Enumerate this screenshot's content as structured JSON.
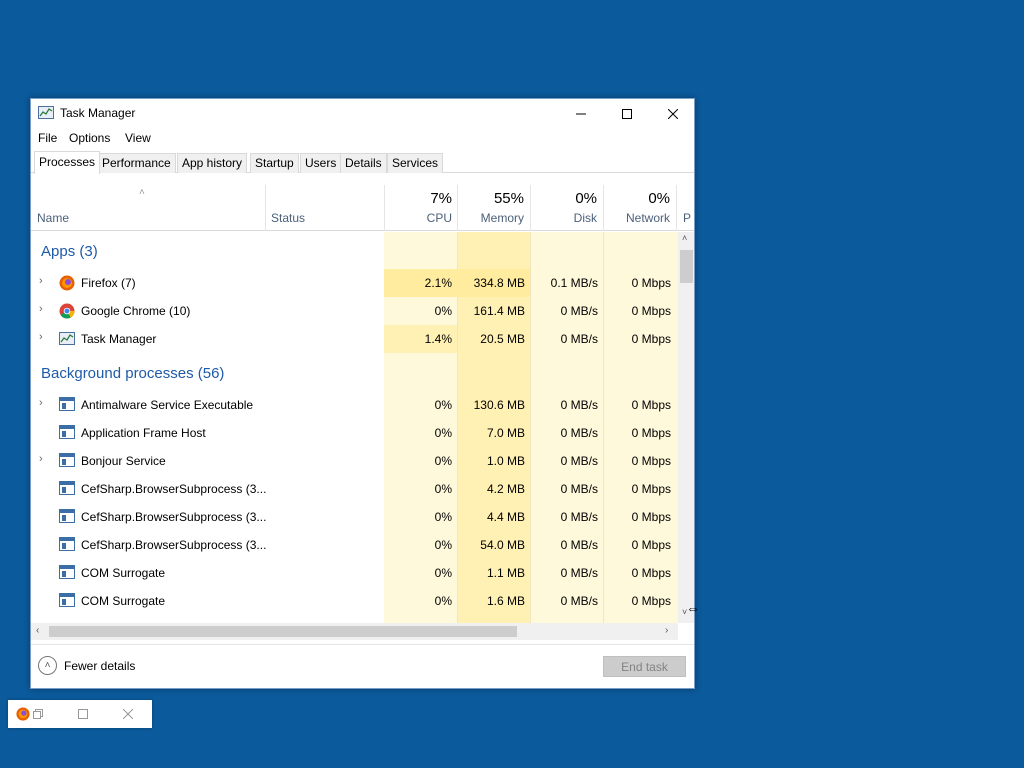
{
  "window": {
    "title": "Task Manager",
    "min_icon": "minimize-icon",
    "max_icon": "maximize-icon",
    "close_icon": "close-icon"
  },
  "menu": [
    "File",
    "Options",
    "View"
  ],
  "tabs": [
    "Processes",
    "Performance",
    "App history",
    "Startup",
    "Users",
    "Details",
    "Services"
  ],
  "columns": {
    "name": "Name",
    "status": "Status",
    "cpu": {
      "pct": "7%",
      "label": "CPU"
    },
    "memory": {
      "pct": "55%",
      "label": "Memory"
    },
    "disk": {
      "pct": "0%",
      "label": "Disk"
    },
    "network": {
      "pct": "0%",
      "label": "Network"
    },
    "extra": "P"
  },
  "groups": {
    "apps": "Apps (3)",
    "background": "Background processes (56)"
  },
  "apps": [
    {
      "name": "Firefox (7)",
      "cpu": "2.1%",
      "mem": "334.8 MB",
      "disk": "0.1 MB/s",
      "net": "0 Mbps"
    },
    {
      "name": "Google Chrome (10)",
      "cpu": "0%",
      "mem": "161.4 MB",
      "disk": "0 MB/s",
      "net": "0 Mbps"
    },
    {
      "name": "Task Manager",
      "cpu": "1.4%",
      "mem": "20.5 MB",
      "disk": "0 MB/s",
      "net": "0 Mbps"
    }
  ],
  "background": [
    {
      "name": "Antimalware Service Executable",
      "cpu": "0%",
      "mem": "130.6 MB",
      "disk": "0 MB/s",
      "net": "0 Mbps"
    },
    {
      "name": "Application Frame Host",
      "cpu": "0%",
      "mem": "7.0 MB",
      "disk": "0 MB/s",
      "net": "0 Mbps"
    },
    {
      "name": "Bonjour Service",
      "cpu": "0%",
      "mem": "1.0 MB",
      "disk": "0 MB/s",
      "net": "0 Mbps"
    },
    {
      "name": "CefSharp.BrowserSubprocess (3...",
      "cpu": "0%",
      "mem": "4.2 MB",
      "disk": "0 MB/s",
      "net": "0 Mbps"
    },
    {
      "name": "CefSharp.BrowserSubprocess (3...",
      "cpu": "0%",
      "mem": "4.4 MB",
      "disk": "0 MB/s",
      "net": "0 Mbps"
    },
    {
      "name": "CefSharp.BrowserSubprocess (3...",
      "cpu": "0%",
      "mem": "54.0 MB",
      "disk": "0 MB/s",
      "net": "0 Mbps"
    },
    {
      "name": "COM Surrogate",
      "cpu": "0%",
      "mem": "1.1 MB",
      "disk": "0 MB/s",
      "net": "0 Mbps"
    },
    {
      "name": "COM Surrogate",
      "cpu": "0%",
      "mem": "1.6 MB",
      "disk": "0 MB/s",
      "net": "0 Mbps"
    }
  ],
  "footer": {
    "fewer_details": "Fewer details",
    "end_task": "End task"
  },
  "colors": {
    "desktop": "#0b5a9c",
    "group_text": "#1e5aa8",
    "heat_light": "#fff4c4",
    "heat_mid": "#ffeba0",
    "heat_faint": "#fff9dc"
  }
}
